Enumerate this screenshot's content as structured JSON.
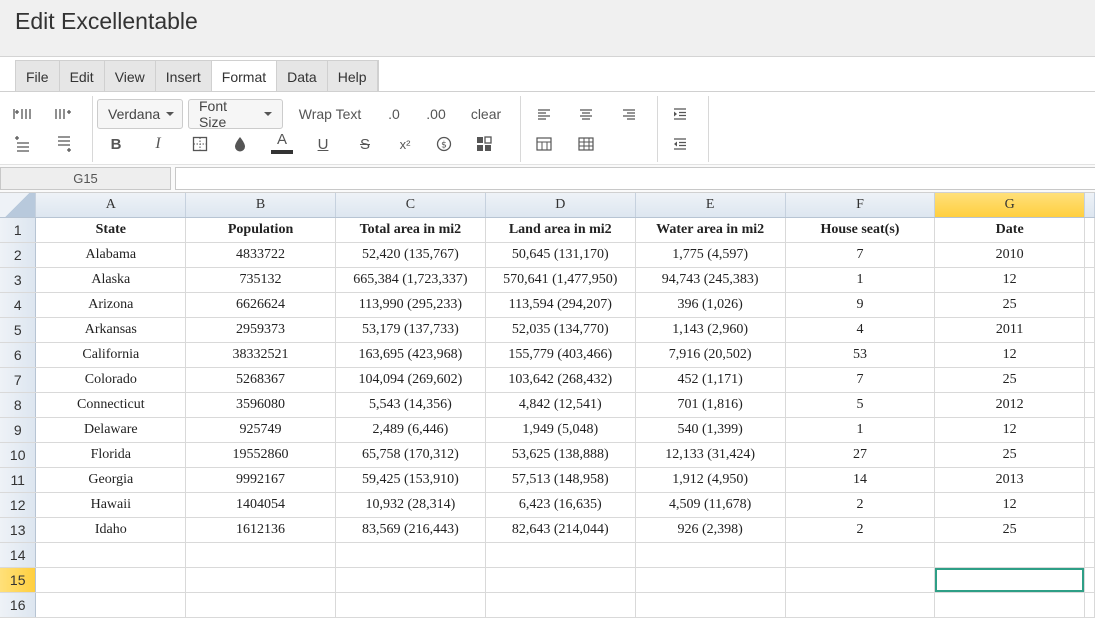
{
  "app": {
    "title": "Edit Excellentable"
  },
  "menu": [
    "File",
    "Edit",
    "View",
    "Insert",
    "Format",
    "Data",
    "Help"
  ],
  "active_menu": "Format",
  "toolbar": {
    "font_family": "Verdana",
    "font_size": "Font Size",
    "wrap_text": "Wrap Text",
    "decrease_decimal": ".0",
    "increase_decimal": ".00",
    "clear": "clear",
    "bold": "B",
    "italic": "I",
    "text_color": "A",
    "underline": "U",
    "strikethrough": "S",
    "superscript": "x²"
  },
  "formula_bar": {
    "cell_ref": "G15",
    "value": ""
  },
  "colors": {
    "accent_selection": "#ffcf3f",
    "active_cell_border": "#2e9f86",
    "header_bg": "#dde6f0"
  },
  "columns": [
    "A",
    "B",
    "C",
    "D",
    "E",
    "F",
    "G"
  ],
  "selected_column": "G",
  "selected_row": "15",
  "row_numbers": [
    "1",
    "2",
    "3",
    "4",
    "5",
    "6",
    "7",
    "8",
    "9",
    "10",
    "11",
    "12",
    "13",
    "14",
    "15",
    "16"
  ],
  "rows": [
    [
      "State",
      "Population",
      "Total area in mi2",
      "Land area in mi2",
      "Water area in mi2",
      "House seat(s)",
      "Date"
    ],
    [
      "Alabama",
      "4833722",
      "52,420 (135,767)",
      "50,645 (131,170)",
      "1,775 (4,597)",
      "7",
      "2010"
    ],
    [
      "Alaska",
      "735132",
      "665,384 (1,723,337)",
      "570,641 (1,477,950)",
      "94,743 (245,383)",
      "1",
      "12"
    ],
    [
      "Arizona",
      "6626624",
      "113,990 (295,233)",
      "113,594 (294,207)",
      "396 (1,026)",
      "9",
      "25"
    ],
    [
      "Arkansas",
      "2959373",
      "53,179 (137,733)",
      "52,035 (134,770)",
      "1,143 (2,960)",
      "4",
      "2011"
    ],
    [
      "California",
      "38332521",
      "163,695 (423,968)",
      "155,779 (403,466)",
      "7,916 (20,502)",
      "53",
      "12"
    ],
    [
      "Colorado",
      "5268367",
      "104,094 (269,602)",
      "103,642 (268,432)",
      "452 (1,171)",
      "7",
      "25"
    ],
    [
      "Connecticut",
      "3596080",
      "5,543 (14,356)",
      "4,842 (12,541)",
      "701 (1,816)",
      "5",
      "2012"
    ],
    [
      "Delaware",
      "925749",
      "2,489 (6,446)",
      "1,949 (5,048)",
      "540 (1,399)",
      "1",
      "12"
    ],
    [
      "Florida",
      "19552860",
      "65,758 (170,312)",
      "53,625 (138,888)",
      "12,133 (31,424)",
      "27",
      "25"
    ],
    [
      "Georgia",
      "9992167",
      "59,425 (153,910)",
      "57,513 (148,958)",
      "1,912 (4,950)",
      "14",
      "2013"
    ],
    [
      "Hawaii",
      "1404054",
      "10,932 (28,314)",
      "6,423 (16,635)",
      "4,509 (11,678)",
      "2",
      "12"
    ],
    [
      "Idaho",
      "1612136",
      "83,569 (216,443)",
      "82,643 (214,044)",
      "926 (2,398)",
      "2",
      "25"
    ],
    [
      "",
      "",
      "",
      "",
      "",
      "",
      ""
    ],
    [
      "",
      "",
      "",
      "",
      "",
      "",
      ""
    ],
    [
      "",
      "",
      "",
      "",
      "",
      "",
      ""
    ]
  ]
}
